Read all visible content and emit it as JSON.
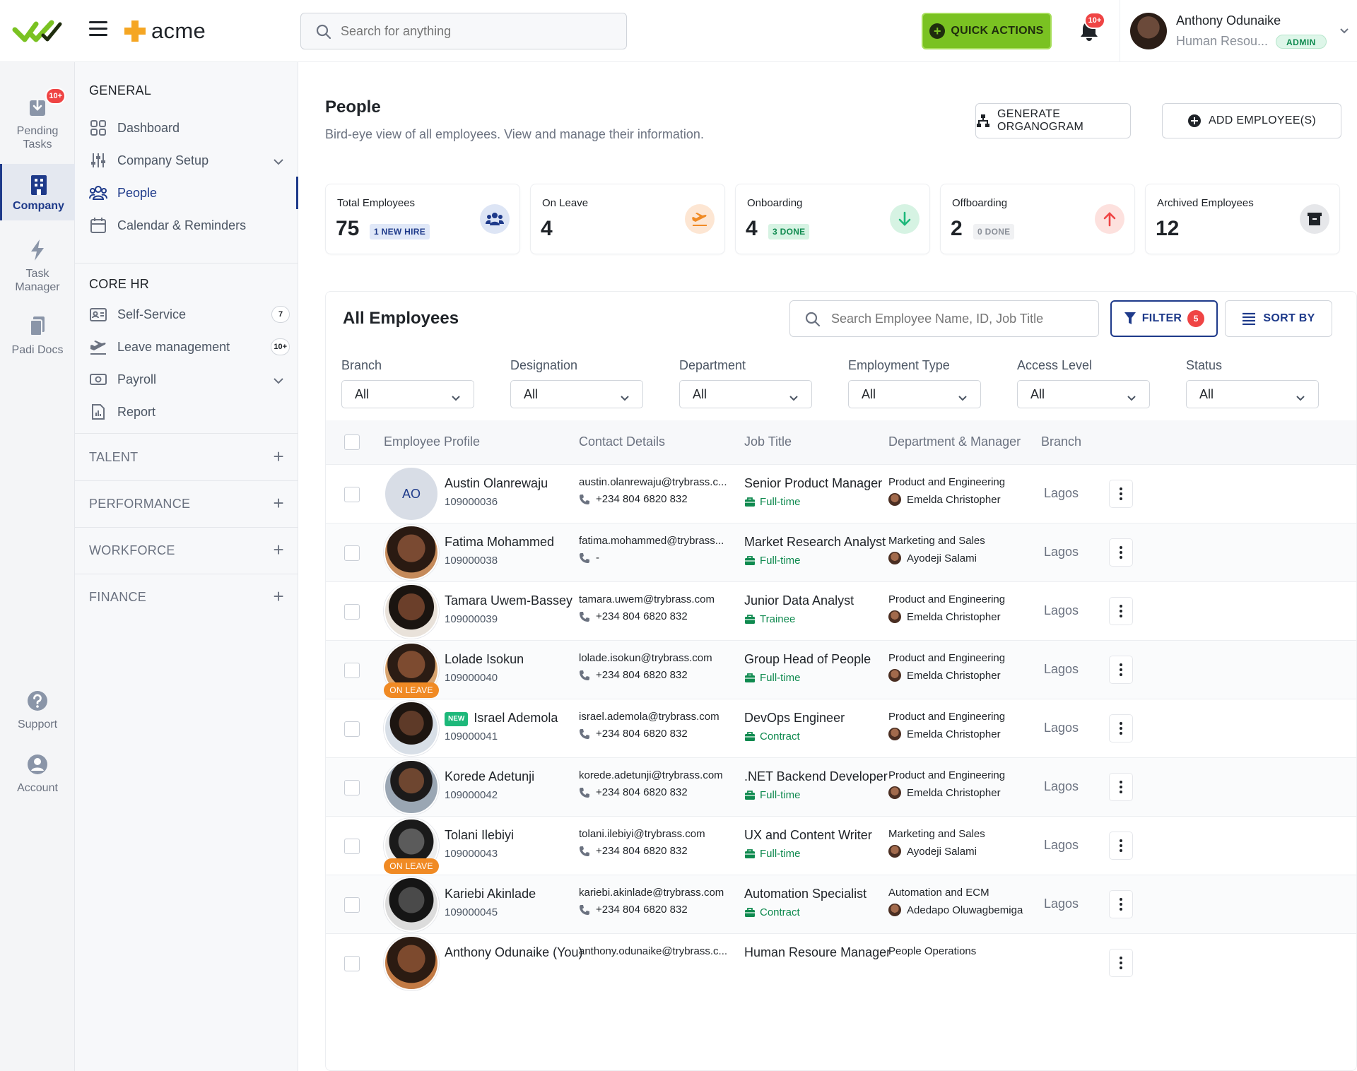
{
  "rail": {
    "items": [
      {
        "label": "Pending\nTasks",
        "badge": "10+"
      },
      {
        "label": "Company"
      },
      {
        "label": "Task\nManager"
      },
      {
        "label": "Padi Docs"
      },
      {
        "label": "Support"
      },
      {
        "label": "Account"
      }
    ]
  },
  "header": {
    "brand": "acme",
    "search_placeholder": "Search for anything",
    "quick_actions": "QUICK ACTIONS",
    "notif_badge": "10+",
    "user_name": "Anthony Odunaike",
    "user_role": "Human Resou...",
    "user_badge": "ADMIN"
  },
  "sidebar": {
    "general_heading": "GENERAL",
    "general": [
      {
        "label": "Dashboard"
      },
      {
        "label": "Company Setup"
      },
      {
        "label": "People"
      },
      {
        "label": "Calendar & Reminders"
      }
    ],
    "corehr_heading": "CORE HR",
    "corehr": [
      {
        "label": "Self-Service",
        "count": "7"
      },
      {
        "label": "Leave management",
        "count": "10+"
      },
      {
        "label": "Payroll"
      },
      {
        "label": "Report"
      }
    ],
    "groups": [
      "TALENT",
      "PERFORMANCE",
      "WORKFORCE",
      "FINANCE"
    ]
  },
  "page": {
    "title": "People",
    "subtitle": "Bird-eye view of all employees. View and manage their information.",
    "btn_organogram": "GENERATE ORGANOGRAM",
    "btn_add": "ADD EMPLOYEE(S)"
  },
  "stats": [
    {
      "label": "Total Employees",
      "value": "75",
      "tag": "1 NEW HIRE"
    },
    {
      "label": "On Leave",
      "value": "4"
    },
    {
      "label": "Onboarding",
      "value": "4",
      "tag": "3 DONE"
    },
    {
      "label": "Offboarding",
      "value": "2",
      "tag": "0 DONE"
    },
    {
      "label": "Archived Employees",
      "value": "12"
    }
  ],
  "colors": {
    "accent": "#1e3a8a",
    "quick_actions": "#7ac222",
    "danger": "#ef4444",
    "success": "#0f8a4f",
    "on_leave": "#f08a24"
  },
  "employees_panel": {
    "title": "All Employees",
    "search_placeholder": "Search Employee Name, ID, Job Title",
    "filter_label": "FILTER",
    "filter_count": "5",
    "sort_label": "SORT BY",
    "filters": [
      {
        "label": "Branch",
        "value": "All"
      },
      {
        "label": "Designation",
        "value": "All"
      },
      {
        "label": "Department",
        "value": "All"
      },
      {
        "label": "Employment Type",
        "value": "All"
      },
      {
        "label": "Access Level",
        "value": "All"
      },
      {
        "label": "Status",
        "value": "All"
      }
    ],
    "columns": [
      "Employee Profile",
      "Contact Details",
      "Job Title",
      "Department & Manager",
      "Branch"
    ],
    "rows": [
      {
        "initials": "AO",
        "name": "Austin Olanrewaju",
        "id": "109000036",
        "email": "austin.olanrewaju@trybrass.c...",
        "phone": "+234 804 6820 832",
        "job": "Senior Product Manager",
        "type": "Full-time",
        "dept": "Product and Engineering",
        "manager": "Emelda Christopher",
        "branch": "Lagos"
      },
      {
        "name": "Fatima Mohammed",
        "id": "109000038",
        "email": "fatima.mohammed@trybrass...",
        "phone": "-",
        "job": "Market Research Analyst",
        "type": "Full-time",
        "dept": "Marketing and Sales",
        "manager": "Ayodeji Salami",
        "branch": "Lagos"
      },
      {
        "name": "Tamara Uwem-Bassey",
        "id": "109000039",
        "email": "tamara.uwem@trybrass.com",
        "phone": "+234 804 6820 832",
        "job": "Junior Data Analyst",
        "type": "Trainee",
        "dept": "Product and Engineering",
        "manager": "Emelda Christopher",
        "branch": "Lagos"
      },
      {
        "name": "Lolade Isokun",
        "id": "109000040",
        "status": "ON LEAVE",
        "email": "lolade.isokun@trybrass.com",
        "phone": "+234 804 6820 832",
        "job": "Group Head of People",
        "type": "Full-time",
        "dept": "Product and Engineering",
        "manager": "Emelda Christopher",
        "branch": "Lagos"
      },
      {
        "name": "Israel Ademola",
        "id": "109000041",
        "new": "NEW",
        "email": "israel.ademola@trybrass.com",
        "phone": "+234 804 6820 832",
        "job": "DevOps Engineer",
        "type": "Contract",
        "dept": "Product and Engineering",
        "manager": "Emelda Christopher",
        "branch": "Lagos"
      },
      {
        "name": "Korede Adetunji",
        "id": "109000042",
        "email": "korede.adetunji@trybrass.com",
        "phone": "+234 804 6820 832",
        "job": ".NET Backend Developer",
        "type": "Full-time",
        "dept": "Product and Engineering",
        "manager": "Emelda Christopher",
        "branch": "Lagos"
      },
      {
        "name": "Tolani Ilebiyi",
        "id": "109000043",
        "status": "ON LEAVE",
        "email": "tolani.ilebiyi@trybrass.com",
        "phone": "+234 804 6820 832",
        "job": "UX and Content Writer",
        "type": "Full-time",
        "dept": "Marketing and Sales",
        "manager": "Ayodeji Salami",
        "branch": "Lagos"
      },
      {
        "name": "Kariebi Akinlade",
        "id": "109000045",
        "email": "kariebi.akinlade@trybrass.com",
        "phone": "+234 804 6820 832",
        "job": "Automation Specialist",
        "type": "Contract",
        "dept": "Automation and ECM",
        "manager": "Adedapo Oluwagbemiga",
        "branch": "Lagos"
      },
      {
        "name": "Anthony Odunaike (You)",
        "email": "anthony.odunaike@trybrass.c...",
        "job": "Human Resoure Manager",
        "dept": "People Operations"
      }
    ]
  }
}
